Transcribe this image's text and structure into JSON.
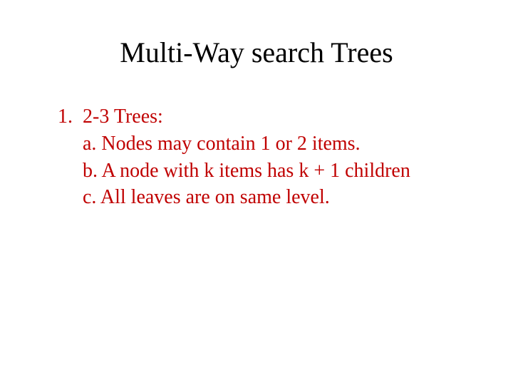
{
  "title": "Multi-Way search Trees",
  "item": {
    "number": "1.",
    "heading": "2-3 Trees:",
    "a": "a. Nodes may contain 1 or 2 items.",
    "b": "b. A node with k items has k + 1 children",
    "c": "c. All leaves are on same level."
  }
}
